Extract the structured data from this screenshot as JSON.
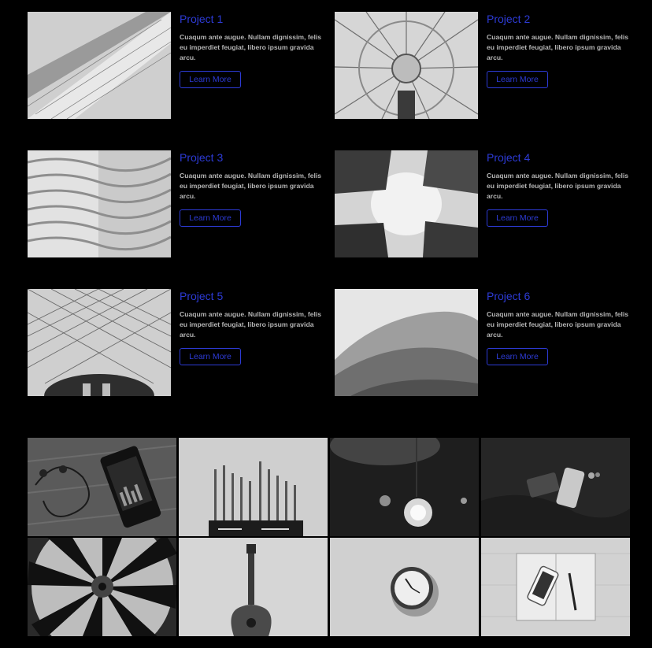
{
  "projects": [
    {
      "title": "Project 1",
      "description": "Cuaqum ante augue. Nullam dignissim, felis eu imperdiet feugiat, libero ipsum gravida arcu.",
      "button": "Learn More"
    },
    {
      "title": "Project 2",
      "description": "Cuaqum ante augue. Nullam dignissim, felis eu imperdiet feugiat, libero ipsum gravida arcu.",
      "button": "Learn More"
    },
    {
      "title": "Project 3",
      "description": "Cuaqum ante augue. Nullam dignissim, felis eu imperdiet feugiat, libero ipsum gravida arcu.",
      "button": "Learn More"
    },
    {
      "title": "Project 4",
      "description": "Cuaqum ante augue. Nullam dignissim, felis eu imperdiet feugiat, libero ipsum gravida arcu.",
      "button": "Learn More"
    },
    {
      "title": "Project 5",
      "description": "Cuaqum ante augue. Nullam dignissim, felis eu imperdiet feugiat, libero ipsum gravida arcu.",
      "button": "Learn More"
    },
    {
      "title": "Project 6",
      "description": "Cuaqum ante augue. Nullam dignissim, felis eu imperdiet feugiat, libero ipsum gravida arcu.",
      "button": "Learn More"
    }
  ],
  "colors": {
    "background": "#000000",
    "accent": "#2d3bd6",
    "text": "#b5b5b5"
  }
}
